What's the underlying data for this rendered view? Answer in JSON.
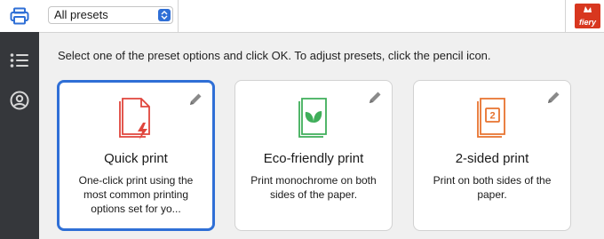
{
  "sidebar": {
    "items": [
      {
        "icon": "printer-icon",
        "active": true
      },
      {
        "icon": "list-icon",
        "active": false
      },
      {
        "icon": "user-icon",
        "active": false
      }
    ]
  },
  "header": {
    "preset_select": {
      "value": "All presets"
    },
    "logo": {
      "text": "fiery",
      "icon": "fiery-logo"
    }
  },
  "instruction": "Select one of the preset options and click OK. To adjust presets, click the pencil icon.",
  "presets": [
    {
      "title": "Quick print",
      "description": "One-click print using the most common printing options set for yo...",
      "icon": "quick-print-icon",
      "selected": true,
      "color": "#e0453c"
    },
    {
      "title": "Eco-friendly print",
      "description": "Print monochrome on both sides of the paper.",
      "icon": "eco-print-icon",
      "selected": false,
      "color": "#3fae5a"
    },
    {
      "title": "2-sided print",
      "description": "Print on both sides of the paper.",
      "icon": "duplex-print-icon",
      "selected": false,
      "color": "#e8732f"
    }
  ],
  "colors": {
    "accent": "#2f6fd6",
    "sidebar": "#35373b",
    "brand": "#d8371f"
  }
}
